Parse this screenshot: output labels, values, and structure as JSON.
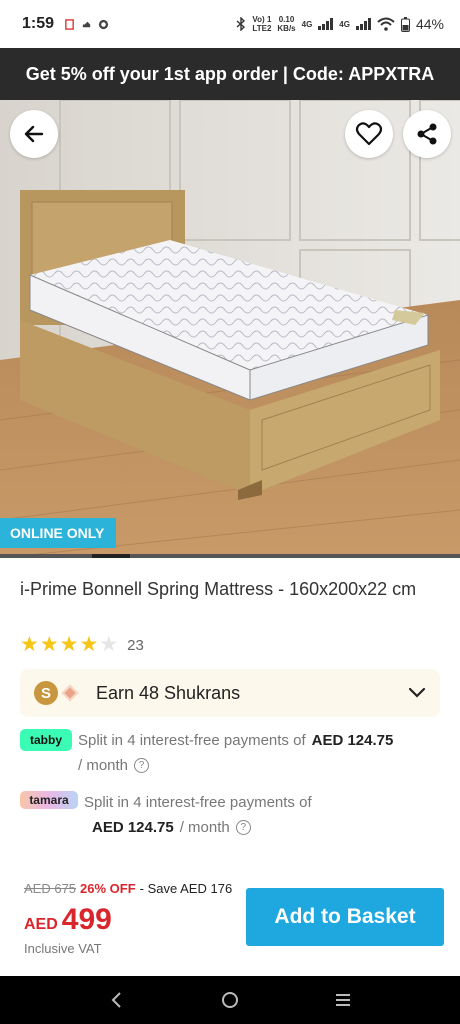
{
  "status_bar": {
    "time": "1:59",
    "network_top": "Vo) 1",
    "network_bottom": "LTE2",
    "speed_top": "0.10",
    "speed_bottom": "KB/s",
    "net1": "4G",
    "net2": "4G",
    "battery_percent": "44%"
  },
  "promo": {
    "text": "Get 5% off your 1st app order | Code: APPXTRA"
  },
  "hero": {
    "badge": "ONLINE ONLY",
    "image_progress": 0.08
  },
  "product": {
    "title": "i-Prime Bonnell Spring Mattress - 160x200x22 cm",
    "rating": 4,
    "rating_max": 5,
    "rating_count": "23"
  },
  "shukran": {
    "coin_letter": "S",
    "text": "Earn 48 Shukrans"
  },
  "tabby": {
    "logo": "tabby",
    "text": "Split in 4 interest-free payments of",
    "amount": "AED 124.75",
    "suffix": "/ month",
    "info": "?"
  },
  "tamara": {
    "logo": "tamara",
    "text": "Split in 4 interest-free payments of",
    "amount": "AED 124.75",
    "suffix": "/ month",
    "info": "?"
  },
  "price": {
    "old": "AED 675",
    "discount": "26% OFF",
    "save": "- Save AED 176",
    "currency": "AED",
    "amount": "499",
    "vat": "Inclusive VAT"
  },
  "actions": {
    "add_to_basket": "Add to Basket"
  },
  "colors": {
    "accent": "#1ea8df",
    "sale_red": "#d9262c",
    "star": "#f5c518",
    "badge": "#2cb3d9",
    "tabby": "#3bfcb4"
  },
  "icons": {
    "back": "arrow-left-icon",
    "favorite": "heart-icon",
    "share": "share-icon",
    "chevron": "chevron-down-icon",
    "nav_back": "nav-back-icon",
    "nav_home": "nav-home-icon",
    "nav_recents": "nav-recents-icon"
  }
}
